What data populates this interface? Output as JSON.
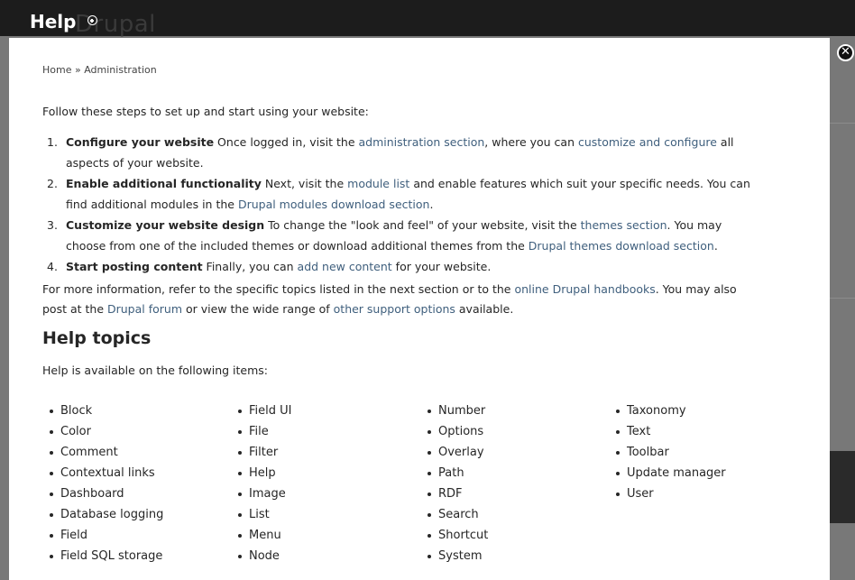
{
  "background": {
    "ghost_logo": "Drupal"
  },
  "overlay": {
    "title": "Help",
    "close_symbol": "✕"
  },
  "breadcrumb": {
    "home": "Home",
    "separator": " » ",
    "current": "Administration"
  },
  "intro": "Follow these steps to set up and start using your website:",
  "steps": [
    {
      "num": "1.",
      "title": "Configure your website",
      "t1": " Once logged in, visit the ",
      "l1": "administration section",
      "t2": ", where you can ",
      "l2": "customize and configure",
      "t3": " all",
      "line2": "aspects of your website."
    },
    {
      "num": "2.",
      "title": "Enable additional functionality",
      "t1": " Next, visit the ",
      "l1": "module list",
      "t2": " and enable features which suit your specific needs. You can",
      "t3": "find additional modules in the ",
      "l2": "Drupal modules download section",
      "t4": "."
    },
    {
      "num": "3.",
      "title": "Customize your website design",
      "t1": " To change the \"look and feel\" of your website, visit the ",
      "l1": "themes section",
      "t2": ". You may",
      "t3": "choose from one of the included themes or download additional themes from the ",
      "l2": "Drupal themes download section",
      "t4": "."
    },
    {
      "num": "4.",
      "title": "Start posting content",
      "t1": " Finally, you can ",
      "l1": "add new content",
      "t2": " for your website."
    }
  ],
  "more_info": {
    "t1": "For more information, refer to the specific topics listed in the next section or to the ",
    "l1": "online Drupal handbooks",
    "t2": ". You may also",
    "t3": "post at the ",
    "l2": "Drupal forum",
    "t4": " or view the wide range of ",
    "l3": "other support options",
    "t5": " available."
  },
  "help_topics": {
    "heading": "Help topics",
    "intro": "Help is available on the following items:",
    "columns": [
      [
        "Block",
        "Color",
        "Comment",
        "Contextual links",
        "Dashboard",
        "Database logging",
        "Field",
        "Field SQL storage"
      ],
      [
        "Field UI",
        "File",
        "Filter",
        "Help",
        "Image",
        "List",
        "Menu",
        "Node"
      ],
      [
        "Number",
        "Options",
        "Overlay",
        "Path",
        "RDF",
        "Search",
        "Shortcut",
        "System"
      ],
      [
        "Taxonomy",
        "Text",
        "Toolbar",
        "Update manager",
        "User"
      ]
    ]
  }
}
